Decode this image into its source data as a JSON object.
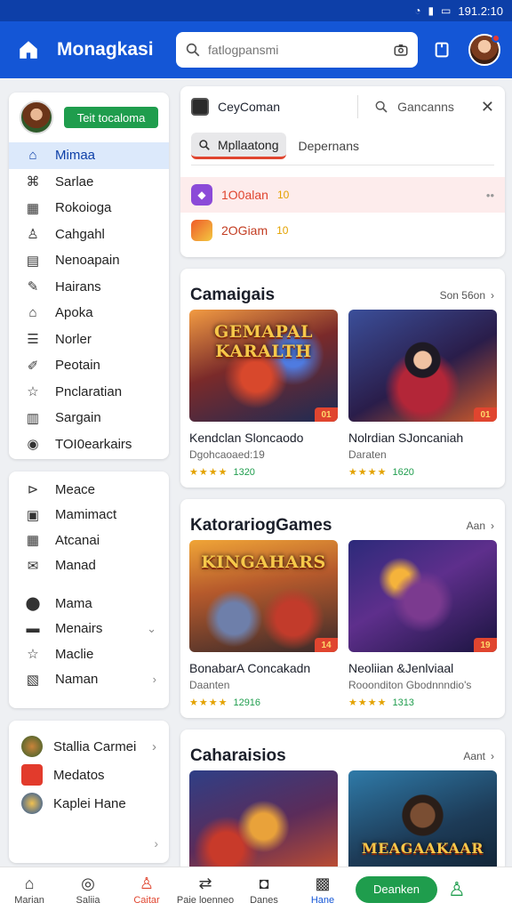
{
  "status": {
    "time": "191.2:10"
  },
  "header": {
    "title": "Monagkasi",
    "search_placeholder": "fatlogpansmi"
  },
  "sidebar": {
    "profile_button": "Teit tocaloma",
    "nav": [
      {
        "label": "Mimaa",
        "icon": "home-icon",
        "active": true
      },
      {
        "label": "Sarlae",
        "icon": "store-icon"
      },
      {
        "label": "Rokoioga",
        "icon": "calendar-icon"
      },
      {
        "label": "Cahgahl",
        "icon": "user-icon"
      },
      {
        "label": "Nenoapain",
        "icon": "document-icon"
      },
      {
        "label": "Hairans",
        "icon": "edit-icon"
      },
      {
        "label": "Apoka",
        "icon": "building-icon"
      },
      {
        "label": "Norler",
        "icon": "list-icon"
      },
      {
        "label": "Peotain",
        "icon": "tool-icon"
      },
      {
        "label": "Pnclaratian",
        "icon": "star-icon"
      },
      {
        "label": "Sargain",
        "icon": "chart-icon"
      },
      {
        "label": "TOI0earkairs",
        "icon": "target-icon"
      }
    ],
    "nav2": [
      {
        "label": "Meace",
        "icon": "tag-icon"
      },
      {
        "label": "Mamimact",
        "icon": "box-icon"
      },
      {
        "label": "Atcanai",
        "icon": "calendar-icon"
      },
      {
        "label": "Manad",
        "icon": "mail-icon"
      },
      {
        "label": "Mama",
        "icon": "location-icon"
      },
      {
        "label": "Menairs",
        "icon": "folder-icon",
        "chevron": "⌄"
      },
      {
        "label": "Maclie",
        "icon": "star-icon"
      },
      {
        "label": "Naman",
        "icon": "briefcase-icon",
        "chevron": "›"
      }
    ],
    "game_links": [
      {
        "label": "Stallia Carmei",
        "chevron": "›"
      },
      {
        "label": "Medatos"
      },
      {
        "label": "Kaplei Hane"
      }
    ]
  },
  "search_panel": {
    "query": "CeyComan",
    "secondary": "Gancanns",
    "tab_active": "Mpllaatong",
    "tab_other": "Depernans",
    "results": [
      {
        "label": "1O0alan",
        "badge": "10",
        "more": "••"
      },
      {
        "label": "2OGiam",
        "badge": "10"
      }
    ]
  },
  "sections": [
    {
      "title": "Camaigais",
      "link": "Son 56on",
      "games": [
        {
          "name": "Kendclan Sloncaodo",
          "sub": "Dgohcaoaed:19",
          "rating": "1320",
          "tag": "01",
          "logo": "GEMAPAL KARALTH"
        },
        {
          "name": "Nolrdian SJoncaniah",
          "sub": "Daraten",
          "rating": "1620",
          "tag": "01",
          "logo": ""
        }
      ]
    },
    {
      "title": "KatorariogGames",
      "link": "Aan",
      "games": [
        {
          "name": "BonabarA Concakadn",
          "sub": "Daanten",
          "rating": "12916",
          "tag": "14",
          "logo": "KINGAHARS"
        },
        {
          "name": "Neoliian &Jenlviaal",
          "sub": "Rooonditon Gbodnnndio's",
          "rating": "1313",
          "tag": "19",
          "logo": ""
        }
      ]
    },
    {
      "title": "Caharaisios",
      "link": "Aant",
      "games": [
        {
          "name": "",
          "sub": "",
          "rating": "",
          "tag": "",
          "logo": ""
        },
        {
          "name": "",
          "sub": "",
          "rating": "",
          "tag": "",
          "logo": "MEAGAAKAAR"
        }
      ]
    }
  ],
  "bottom_nav": [
    {
      "label": "Marian",
      "icon": "home-icon"
    },
    {
      "label": "Saliia",
      "icon": "compass-icon"
    },
    {
      "label": "Caitar",
      "icon": "profile-icon",
      "accent": true
    },
    {
      "label": "Paie loenneo",
      "icon": "shuffle-icon"
    },
    {
      "label": "Danes",
      "icon": "gamepad-icon"
    },
    {
      "label": "Hane",
      "icon": "grid-icon",
      "blue": true
    }
  ],
  "bottom_cta": "Deanken",
  "colors": {
    "primary": "#1456d6",
    "accent": "#e0452f",
    "green": "#1f9d4d"
  }
}
